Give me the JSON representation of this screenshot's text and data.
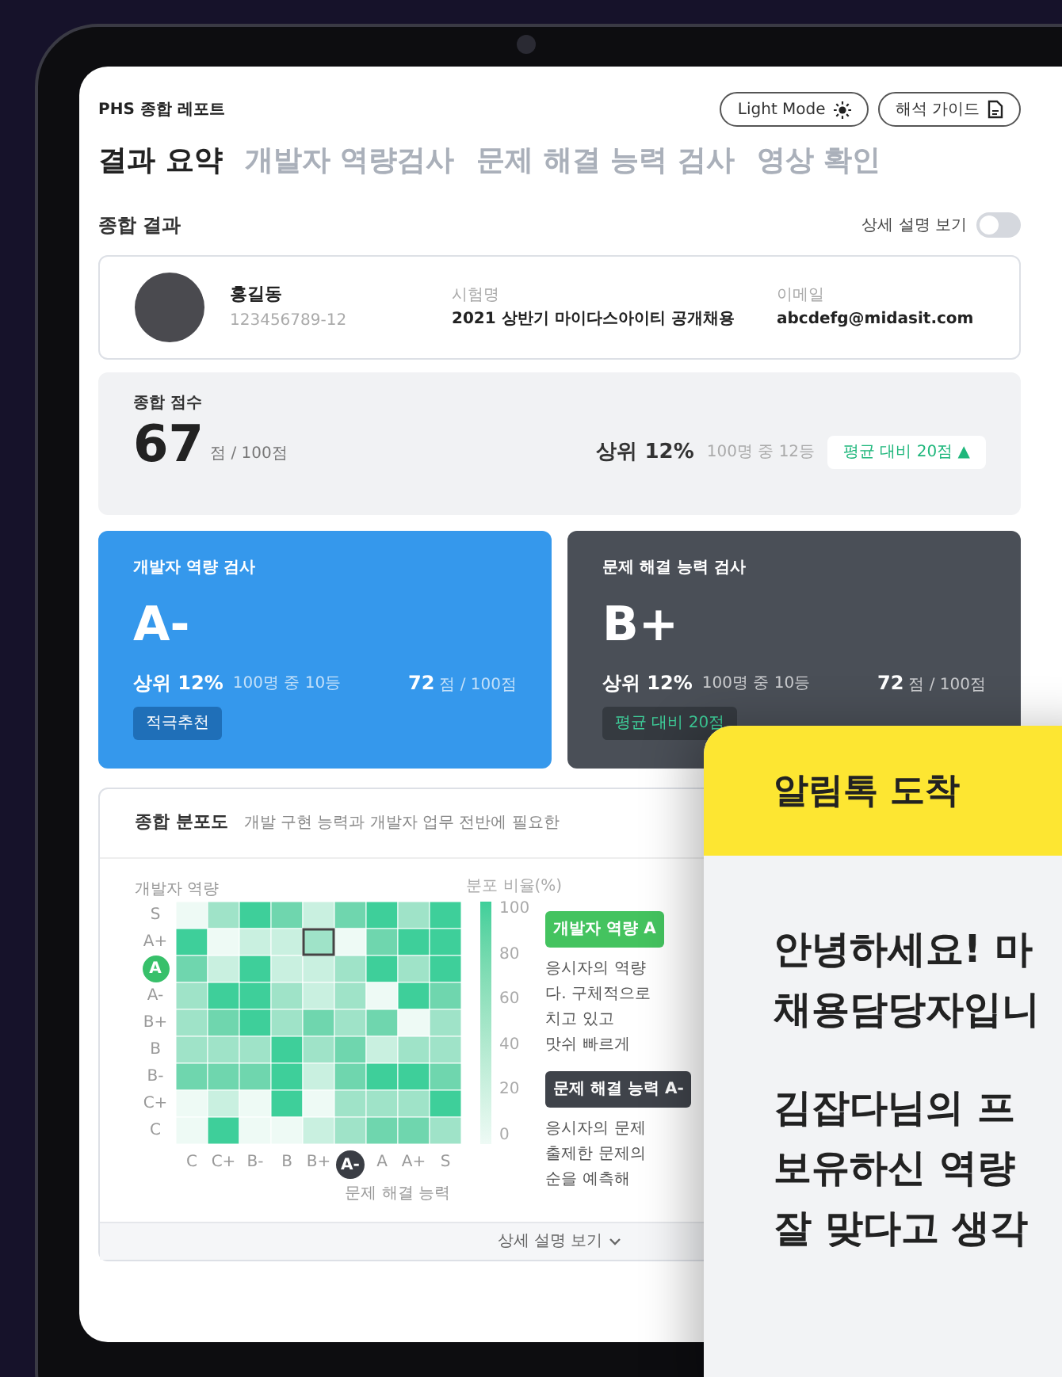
{
  "header": {
    "title": "PHS 종합 레포트",
    "buttons": [
      {
        "label": "Light Mode",
        "kind": "theme"
      },
      {
        "label": "해석 가이드",
        "kind": "guide"
      }
    ]
  },
  "tabs": [
    {
      "label": "결과 요약",
      "selected": true
    },
    {
      "label": "개발자 역량검사",
      "selected": false
    },
    {
      "label": "문제 해결 능력 검사",
      "selected": false
    },
    {
      "label": "영상 확인",
      "selected": false
    }
  ],
  "section": {
    "title": "종합 결과",
    "toggle_label": "상세 설명 보기",
    "toggle_on": false
  },
  "profile": {
    "name": "홍길동",
    "id": "123456789-12",
    "fields": [
      {
        "label": "시험명",
        "value": "2021 상반기 마이다스아이티 공개채용"
      },
      {
        "label": "이메일",
        "value": "abcdefg@midasit.com"
      }
    ]
  },
  "total": {
    "label": "종합 점수",
    "score": "67",
    "unit": "점 / 100점",
    "rank": "상위 12%",
    "rank_note": "100명 중 12등",
    "badge": "평균 대비 20점 ▲"
  },
  "cards": [
    {
      "kind": "blue",
      "title": "개발자 역량 검사",
      "grade": "A-",
      "rank": "상위 12%",
      "rank_note": "100명 중 10등",
      "score": "72",
      "unit": "점 / 100점",
      "tag": "적극추천"
    },
    {
      "kind": "dark",
      "title": "문제 해결 능력 검사",
      "grade": "B+",
      "rank": "상위 12%",
      "rank_note": "100명 중 10등",
      "score": "72",
      "unit": "점 / 100점",
      "tag": "평균 대비 20점"
    }
  ],
  "distribution": {
    "title": "종합 분포도",
    "description": "개발 구현 능력과 개발자 업무 전반에 필요한",
    "y_title": "개발자 역량",
    "x_title": "문제 해결 능력",
    "scale_title": "분포 비율(%)",
    "scale_ticks": [
      "100",
      "80",
      "60",
      "40",
      "20",
      "0"
    ],
    "y_labels": [
      {
        "label": "S",
        "selected": false
      },
      {
        "label": "A+",
        "selected": false
      },
      {
        "label": "A",
        "selected": true
      },
      {
        "label": "A-",
        "selected": false
      },
      {
        "label": "B+",
        "selected": false
      },
      {
        "label": "B",
        "selected": false
      },
      {
        "label": "B-",
        "selected": false
      },
      {
        "label": "C+",
        "selected": false
      },
      {
        "label": "C",
        "selected": false
      }
    ],
    "x_labels": [
      {
        "label": "C",
        "selected": false
      },
      {
        "label": "C+",
        "selected": false
      },
      {
        "label": "B-",
        "selected": false
      },
      {
        "label": "B",
        "selected": false
      },
      {
        "label": "B+",
        "selected": false
      },
      {
        "label": "A-",
        "selected": true
      },
      {
        "label": "A",
        "selected": false
      },
      {
        "label": "A+",
        "selected": false
      },
      {
        "label": "S",
        "selected": false
      }
    ],
    "notes": [
      {
        "kind": "green",
        "label": "개발자 역량",
        "grade": "A",
        "text": "응시자의 역량\n다.  구체적으로\n치고 있고\n맛쉬 빠르게"
      },
      {
        "kind": "dark",
        "label": "문제 해결 능력",
        "grade": "A-",
        "text": "응시자의 문제\n출제한 문제의\n순을 예측해"
      }
    ],
    "more": "상세 설명 보기"
  },
  "notification": {
    "title": "알림톡 도착",
    "lines": [
      "안녕하세요! 마",
      "채용담당자입니",
      "김잡다님의 프",
      "보유하신 역량",
      "잘 맞다고 생각"
    ]
  }
}
